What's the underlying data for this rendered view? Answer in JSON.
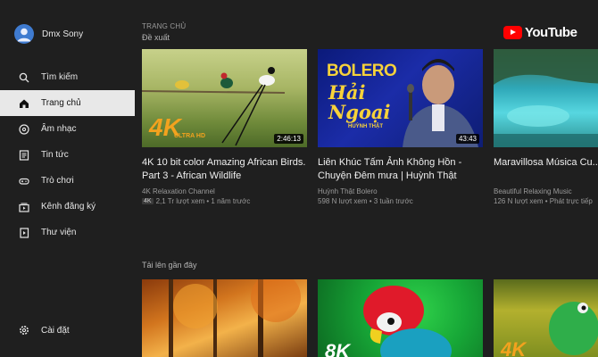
{
  "account": {
    "name": "Dmx Sony"
  },
  "nav": [
    {
      "label": "Tìm kiếm",
      "icon": "search-icon"
    },
    {
      "label": "Trang chủ",
      "icon": "home-icon",
      "active": true
    },
    {
      "label": "Âm nhạc",
      "icon": "music-disc-icon"
    },
    {
      "label": "Tin tức",
      "icon": "news-icon"
    },
    {
      "label": "Trò chơi",
      "icon": "gamepad-icon"
    },
    {
      "label": "Kênh đăng ký",
      "icon": "subscriptions-icon"
    },
    {
      "label": "Thư viện",
      "icon": "library-icon"
    }
  ],
  "settings": {
    "label": "Cài đặt",
    "icon": "gear-icon"
  },
  "header": {
    "section_label": "TRANG CHỦ",
    "section_sub": "Đề xuất",
    "logo_word": "YouTube"
  },
  "videos": [
    {
      "title": "4K 10 bit color Amazing African Birds. Part 3 - African Wildlife",
      "channel": "4K Relaxation Channel",
      "badge": "4K",
      "meta": "2,1 Tr lượt xem • 1 năm trước",
      "duration": "2:46:13",
      "thumb_text": "4K",
      "thumb_sub": "ULTRA HD"
    },
    {
      "title": "Liên Khúc Tấm Ảnh Không Hồn - Chuyện Đêm mưa | Huỳnh Thật",
      "channel": "Huỳnh Thật Bolero",
      "meta": "598 N lượt xem • 3 tuần trước",
      "duration": "43:43",
      "thumb_text": "BOLERO",
      "thumb_sub": "Hải Ngoại",
      "thumb_name": "HUỲNH THẬT"
    },
    {
      "title": "Maravillosa Música Cu... Calmar la Mente y Aliv...",
      "channel": "Beautiful Relaxing Music",
      "meta": "126 N lượt xem • Phát trực tiếp"
    }
  ],
  "uploads": {
    "label": "Tải lên gần đây",
    "thumbs": [
      {
        "text": ""
      },
      {
        "text": "8K"
      },
      {
        "text": "4K"
      }
    ]
  },
  "colors": {
    "background": "#1f1f1f",
    "active_nav": "#e8e8e8",
    "brand_red": "#ff0000",
    "fourk_orange": "#f3a21e"
  }
}
